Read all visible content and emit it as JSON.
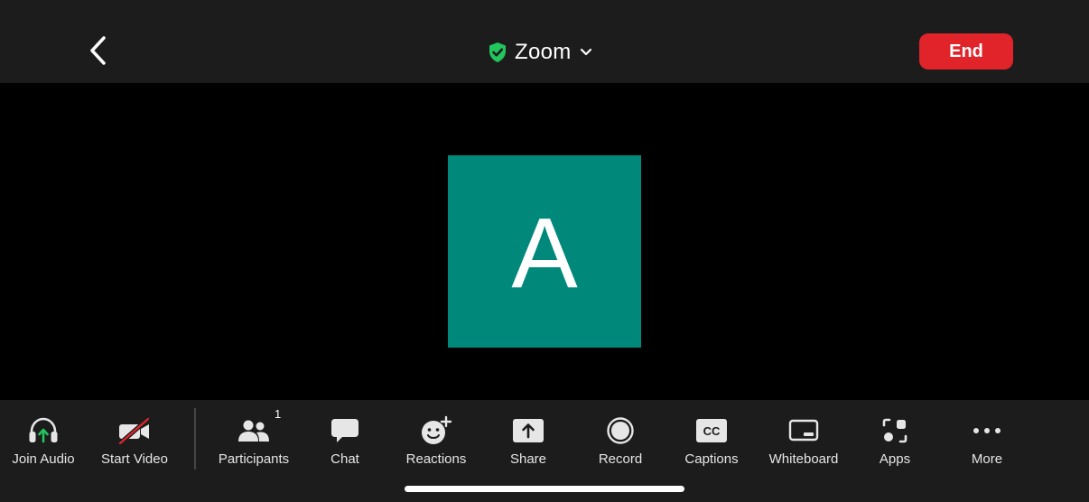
{
  "header": {
    "title": "Zoom",
    "end_label": "End"
  },
  "participant": {
    "initial": "A"
  },
  "toolbar": {
    "join_audio": "Join Audio",
    "start_video": "Start Video",
    "participants": "Participants",
    "participants_count": "1",
    "chat": "Chat",
    "reactions": "Reactions",
    "share": "Share",
    "record": "Record",
    "captions": "Captions",
    "captions_icon_text": "CC",
    "whiteboard": "Whiteboard",
    "apps": "Apps",
    "more": "More"
  },
  "colors": {
    "end_button": "#e0242a",
    "avatar_bg": "#00897b",
    "shield": "#22c55e",
    "audio_arrow": "#22c55e",
    "video_slash": "#e0242a",
    "bar_bg": "#1c1c1c"
  },
  "icons": [
    "chevron-left-icon",
    "shield-check-icon",
    "chevron-down-icon",
    "headphones-icon",
    "video-off-icon",
    "people-icon",
    "chat-icon",
    "smiley-plus-icon",
    "share-arrow-icon",
    "record-icon",
    "cc-icon",
    "whiteboard-icon",
    "apps-icon",
    "more-dots-icon"
  ]
}
